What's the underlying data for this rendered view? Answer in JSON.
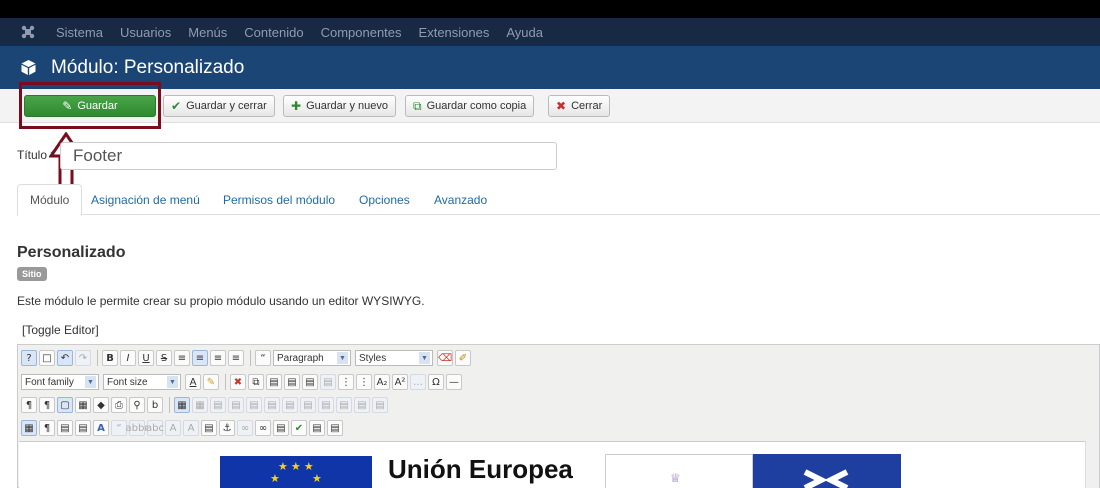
{
  "menu": {
    "items": [
      "Sistema",
      "Usuarios",
      "Menús",
      "Contenido",
      "Componentes",
      "Extensiones",
      "Ayuda"
    ]
  },
  "header": {
    "title": "Módulo: Personalizado"
  },
  "toolbar": {
    "save_label": "Guardar",
    "save_close_label": "Guardar y cerrar",
    "save_new_label": "Guardar y nuevo",
    "save_copy_label": "Guardar como copia",
    "close_label": "Cerrar"
  },
  "form": {
    "title_label": "Título *",
    "title_value": "Footer"
  },
  "tabs": [
    "Módulo",
    "Asignación de menú",
    "Permisos del módulo",
    "Opciones",
    "Avanzado"
  ],
  "module": {
    "heading": "Personalizado",
    "badge": "Sitio",
    "description": "Este módulo le permite crear su propio módulo usando un editor WYSIWYG.",
    "toggle_editor": "[Toggle Editor]"
  },
  "editor": {
    "format_select": "Paragraph",
    "styles_select": "Styles",
    "font_family_select": "Font family",
    "font_size_select": "Font size",
    "content_heading": "Unión Europea"
  },
  "colors": {
    "menubar": "#182a43",
    "titlebar": "#1b4575",
    "save_button": "#2f8a2f",
    "highlight": "#7a0d1d",
    "link": "#1e6ba8"
  }
}
